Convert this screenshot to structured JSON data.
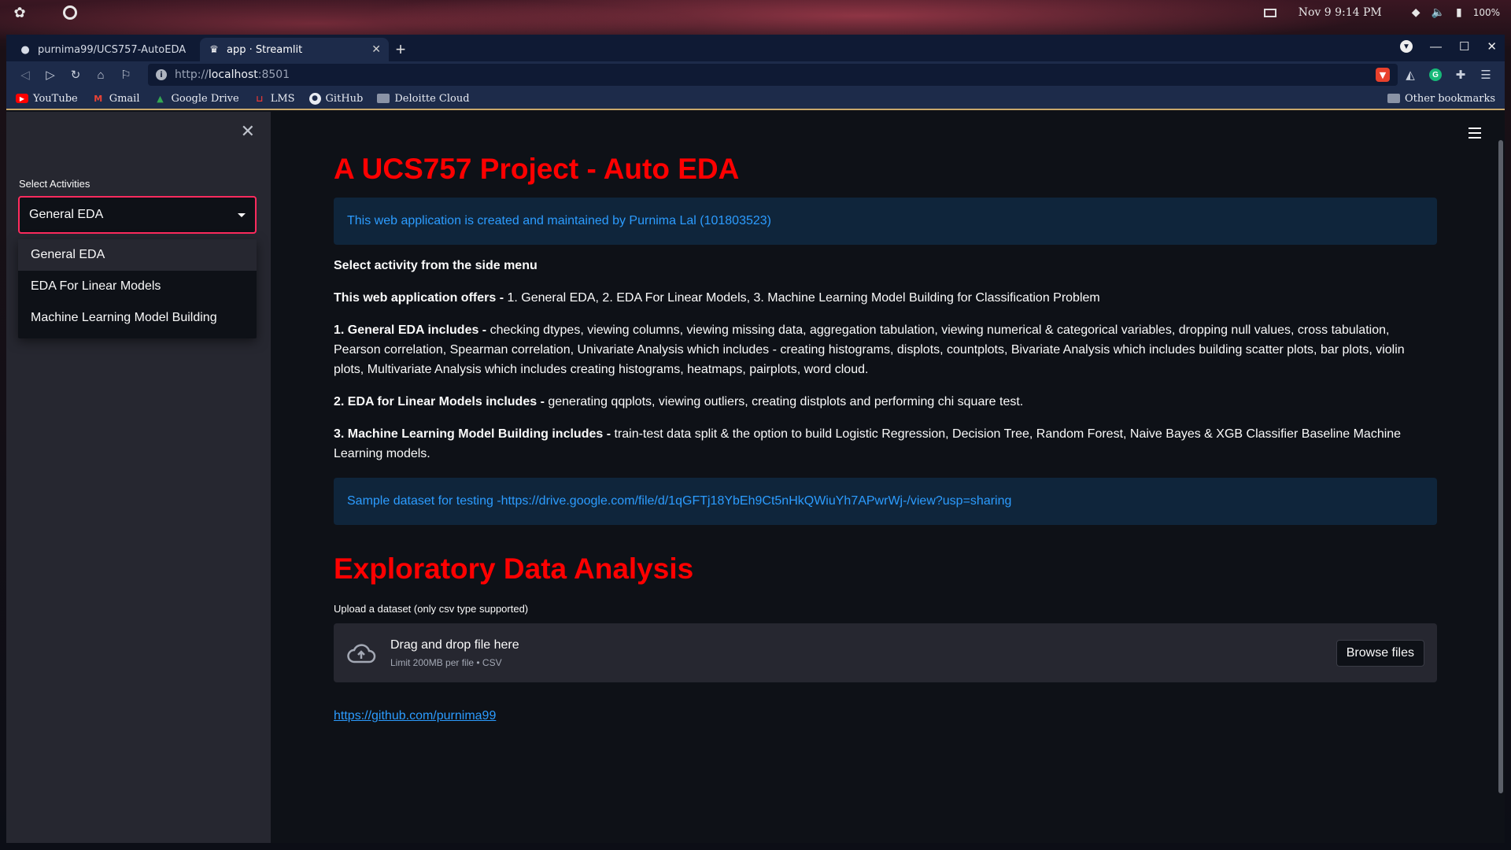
{
  "system": {
    "clock": "Nov 9  9:14 PM",
    "battery": "100%"
  },
  "browser": {
    "tabs": [
      {
        "title": "purnima99/UCS757-AutoEDA",
        "icon": "github-icon",
        "active": false
      },
      {
        "title": "app · Streamlit",
        "icon": "streamlit-icon",
        "active": true
      }
    ],
    "url_scheme": "http://",
    "url_host": "localhost",
    "url_port": ":8501",
    "bookmarks": [
      {
        "label": "YouTube",
        "icon": "youtube-icon"
      },
      {
        "label": "Gmail",
        "icon": "gmail-icon"
      },
      {
        "label": "Google Drive",
        "icon": "google-drive-icon"
      },
      {
        "label": "LMS",
        "icon": "lms-icon"
      },
      {
        "label": "GitHub",
        "icon": "github-icon"
      },
      {
        "label": "Deloitte Cloud",
        "icon": "folder-icon"
      }
    ],
    "other_bookmarks": "Other bookmarks"
  },
  "sidebar": {
    "select_label": "Select Activities",
    "selected": "General EDA",
    "options": [
      "General EDA",
      "EDA For Linear Models",
      "Machine Learning Model Building"
    ]
  },
  "main": {
    "title": "A UCS757 Project - Auto EDA",
    "info": "This web application is created and maintained by Purnima Lal (101803523)",
    "select_hint": "Select activity from the side menu",
    "offers_bold": "This web application offers -",
    "offers_text": " 1. General EDA, 2. EDA For Linear Models, 3. Machine Learning Model Building for Classification Problem",
    "p1_bold": "1. General EDA includes -",
    "p1_text": " checking dtypes, viewing columns, viewing missing data, aggregation tabulation, viewing numerical & categorical variables, dropping null values, cross tabulation, Pearson correlation, Spearman correlation, Univariate Analysis which includes - creating histograms, displots, countplots, Bivariate Analysis which includes building scatter plots, bar plots, violin plots, Multivariate Analysis which includes creating histograms, heatmaps, pairplots, word cloud.",
    "p2_bold": "2. EDA for Linear Models includes -",
    "p2_text": " generating qqplots, viewing outliers, creating distplots and performing chi square test.",
    "p3_bold": "3. Machine Learning Model Building includes -",
    "p3_text": " train-test data split & the option to build Logistic Regression, Decision Tree, Random Forest, Naive Bayes & XGB Classifier Baseline Machine Learning models.",
    "sample_prefix": "Sample dataset for testing -",
    "sample_link": "https://drive.google.com/file/d/1qGFTj18YbEh9Ct5nHkQWiuYh7APwrWj-/view?usp=sharing",
    "section_title": "Exploratory Data Analysis",
    "upload_label": "Upload a dataset (only csv type supported)",
    "drop_title": "Drag and drop file here",
    "drop_limit": "Limit 200MB per file • CSV",
    "browse_label": "Browse files",
    "footer_link": "https://github.com/purnima99"
  },
  "colors": {
    "accent_red": "#ff0000",
    "select_border": "#ff2b5e",
    "info_text": "#2c9cff"
  }
}
